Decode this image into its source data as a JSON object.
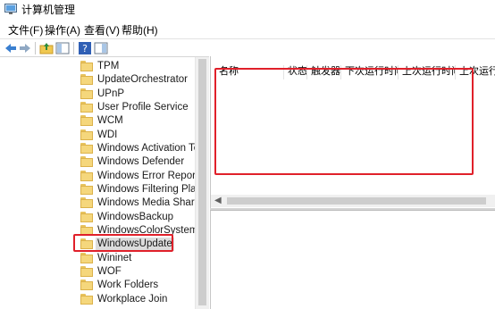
{
  "window": {
    "title": "计算机管理"
  },
  "menu": [
    "文件(F)",
    "操作(A)",
    "查看(V)",
    "帮助(H)"
  ],
  "toolbar": {
    "buttons": [
      "back-arrow-icon",
      "forward-arrow-icon",
      "up-folder-icon",
      "show-tree-icon",
      "help-icon",
      "show-pane-icon"
    ]
  },
  "tree": {
    "items": [
      "TPM",
      "UpdateOrchestrator",
      "UPnP",
      "User Profile Service",
      "WCM",
      "WDI",
      "Windows Activation Tech",
      "Windows Defender",
      "Windows Error Reportin",
      "Windows Filtering Platfo",
      "Windows Media Sharing",
      "WindowsBackup",
      "WindowsColorSystem",
      "WindowsUpdate",
      "Wininet",
      "WOF",
      "Work Folders",
      "Workplace Join"
    ],
    "selected": "WindowsUpdate"
  },
  "list": {
    "columns": [
      "名称",
      "状态",
      "触发器",
      "下次运行时间",
      "上次运行时间",
      "上次运行"
    ]
  },
  "colors": {
    "highlight": "#e0202a",
    "folder": "#f5d77c"
  }
}
